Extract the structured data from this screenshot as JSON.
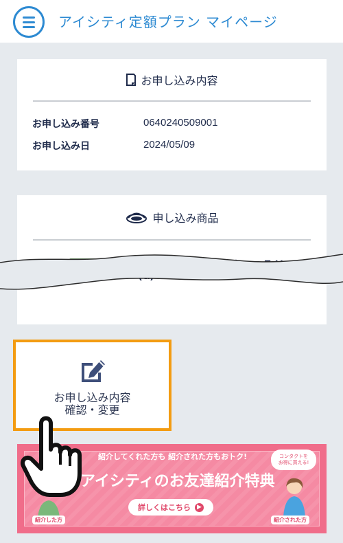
{
  "header": {
    "title": "アイシティ定額プラン マイページ"
  },
  "application": {
    "heading": "お申し込み内容",
    "rows": [
      {
        "label": "お申し込み番号",
        "value": "0640240509001"
      },
      {
        "label": "お申し込み日",
        "value": "2024/05/09"
      }
    ]
  },
  "product": {
    "heading": "申し込み商品",
    "name": "R:ＨＯＹＡマルチピューＥＸ",
    "name_cont": "(α)"
  },
  "confirm_button": {
    "label": "お申し込み内容\n確認・変更"
  },
  "banner": {
    "top_text": "紹介してくれた方も 紹介された方もおトク!",
    "main_text": "アイシティのお友達紹介特典",
    "cta": "詳しくはこちら",
    "bubble_line1": "コンタクトを",
    "bubble_line2": "お得に買える!",
    "tag_left": "紹介した方",
    "tag_right": "紹介された方"
  },
  "colors": {
    "accent": "#2d8ad2",
    "highlight": "#f39c12",
    "banner": "#f06d8a"
  }
}
